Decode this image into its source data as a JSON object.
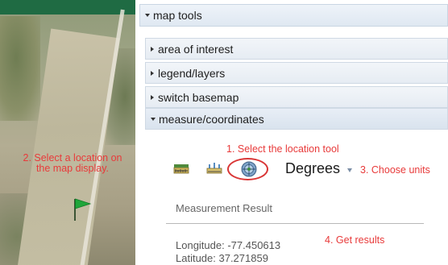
{
  "panel": {
    "title": "map tools",
    "sections": [
      {
        "label": "area of interest"
      },
      {
        "label": "legend/layers"
      },
      {
        "label": "switch basemap"
      },
      {
        "label": "measure/coordinates"
      }
    ]
  },
  "measure": {
    "tools": [
      {
        "icon": "area-tool-icon"
      },
      {
        "icon": "distance-tool-icon"
      },
      {
        "icon": "location-tool-icon",
        "selected": true
      }
    ],
    "units": {
      "value": "Degrees"
    },
    "result": {
      "title": "Measurement Result",
      "longitude": "Longitude: -77.450613",
      "latitude": "Latitude: 37.271859"
    }
  },
  "annotations": {
    "step1": "1. Select the location tool",
    "step2": "2. Select a location on the map display.",
    "step3": "3. Choose units",
    "step4": "4. Get results",
    "color": "#e83a3a"
  },
  "colors": {
    "header_bg": "#dfe8f2",
    "section_border": "#cfd9e4",
    "map_bar": "#1f6b43"
  }
}
